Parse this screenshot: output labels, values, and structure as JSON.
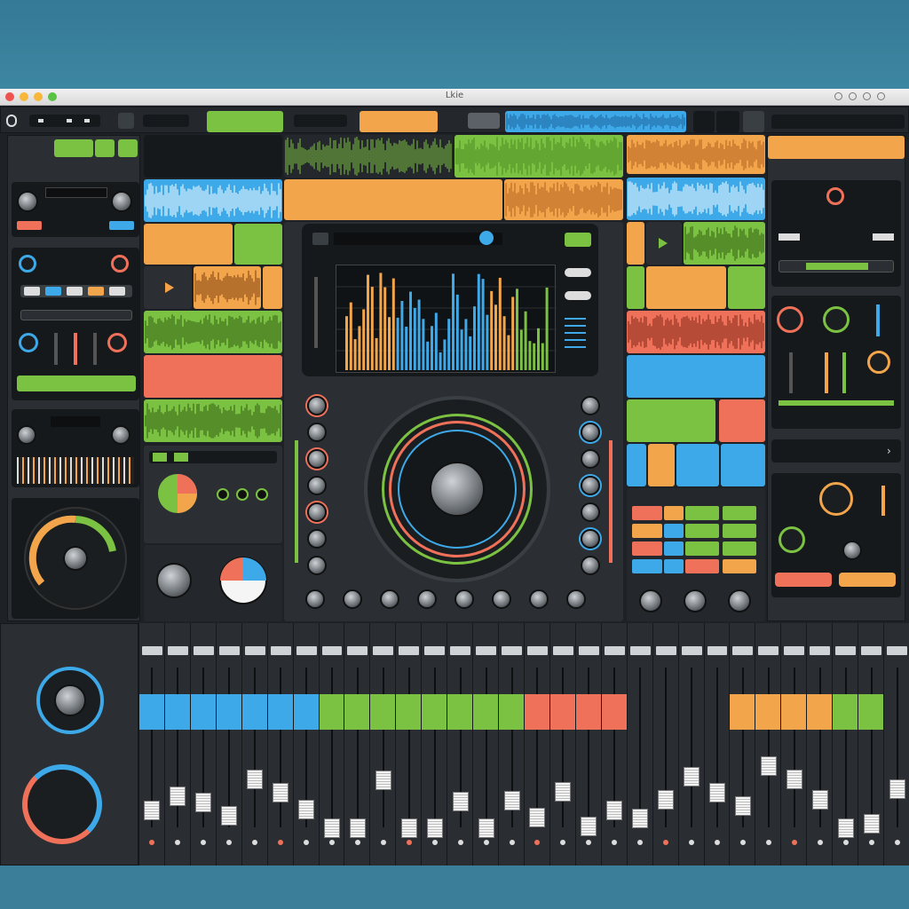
{
  "window": {
    "title": "Lkie"
  },
  "toolbar": {
    "button_a": "",
    "button_b": "",
    "button_c": "",
    "clip_label_green": "",
    "clip_label_orange": "",
    "clip_label_gray": ""
  },
  "left_panel": {
    "header_label": "",
    "mixer_display": "",
    "module_label": ""
  },
  "right_panel": {
    "header_label": "",
    "module_label": "",
    "btn_left": "",
    "btn_right": ""
  },
  "pads_panel": {
    "header_label": ""
  },
  "mixer": {
    "left_label": "",
    "channels": 30
  },
  "colors": {
    "green": "#7cc242",
    "orange": "#f2a54a",
    "blue": "#3da9e8",
    "coral": "#f0715a",
    "panel": "#2b2f34",
    "bg": "#3f7f9a"
  },
  "icons": [
    "record-icon",
    "play-icon",
    "settings-icon",
    "close-icon",
    "help-icon"
  ]
}
